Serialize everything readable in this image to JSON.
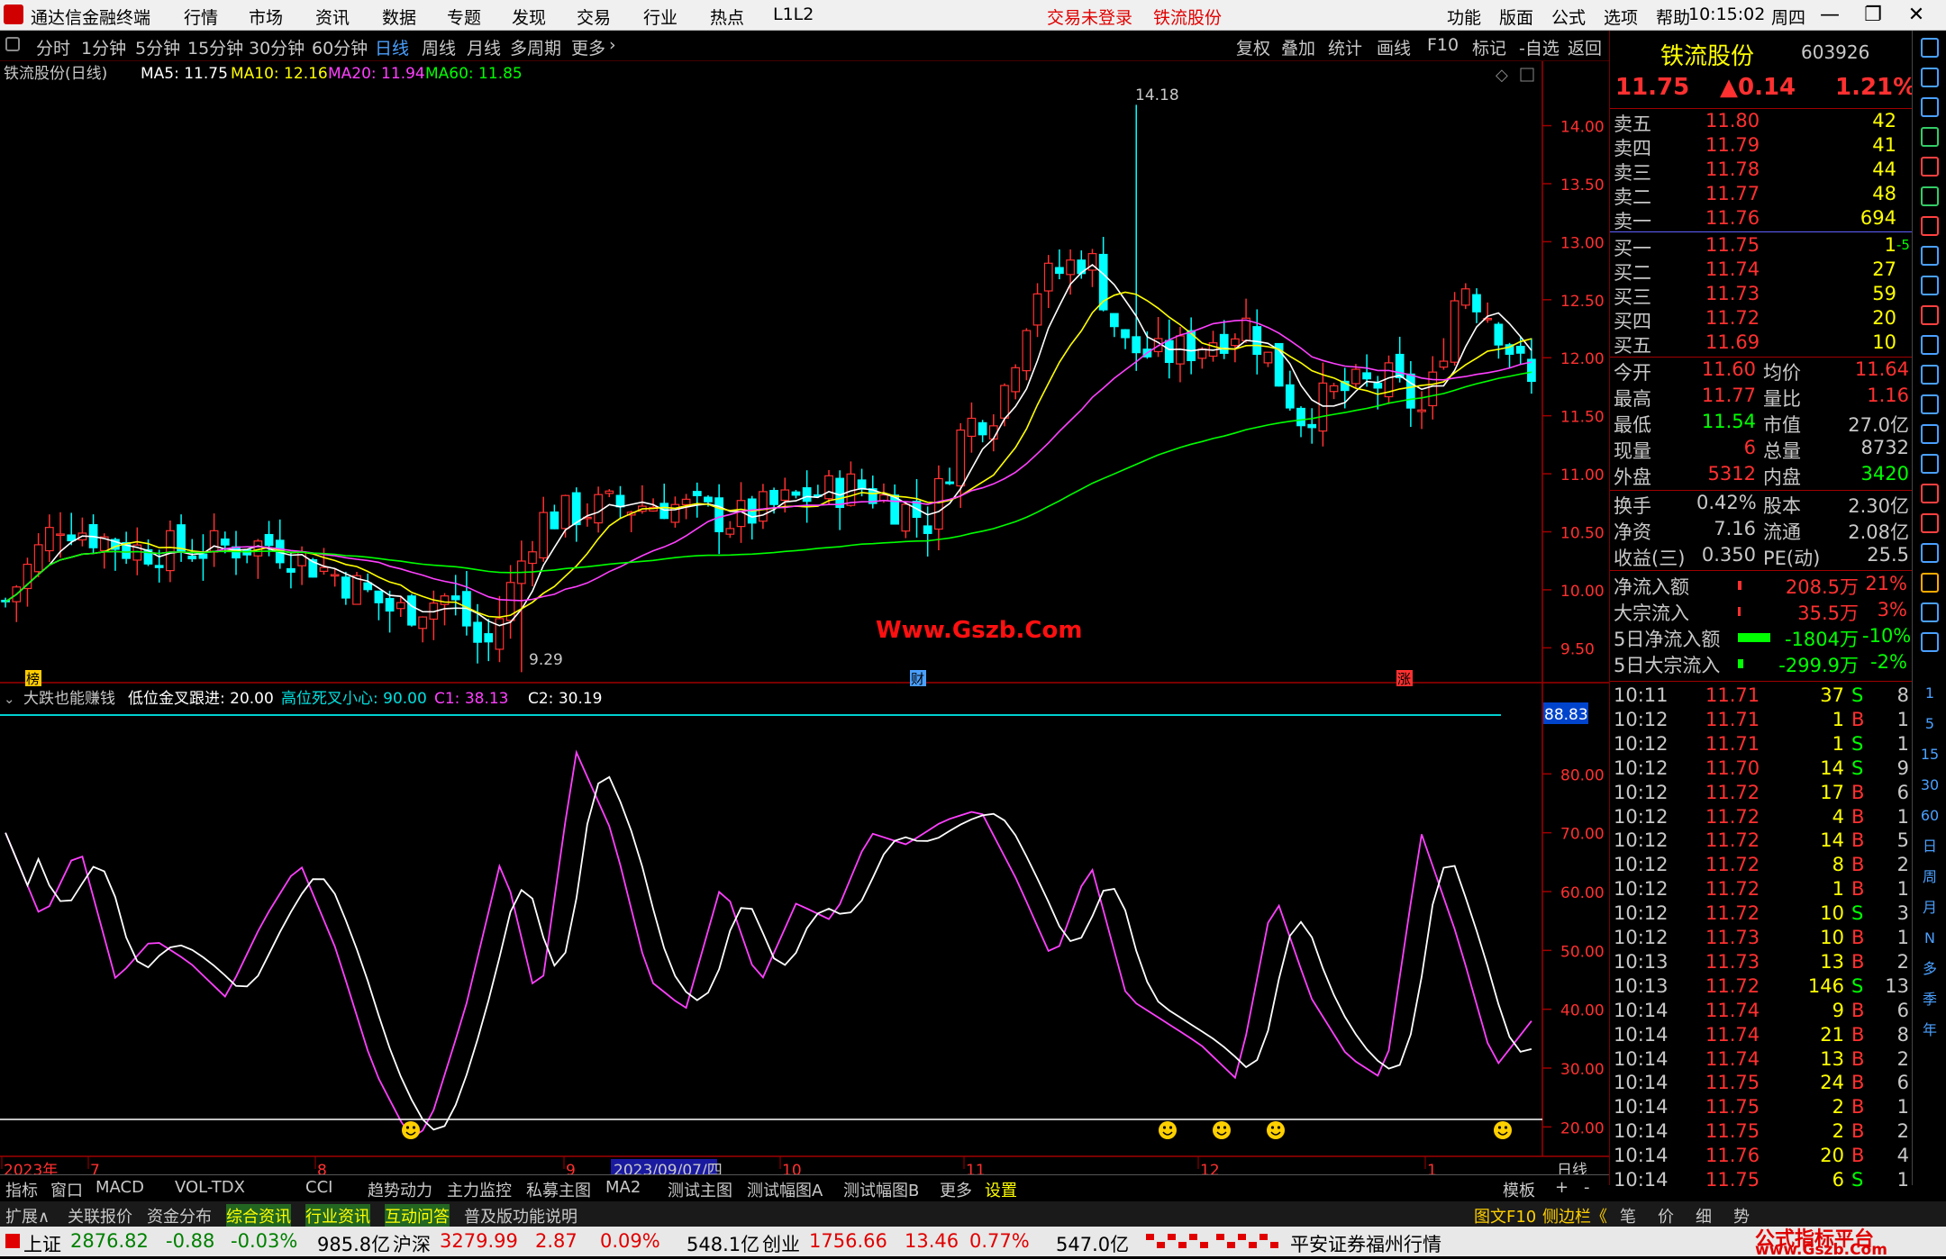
{
  "app": {
    "title": "通达信金融终端",
    "menus": [
      "行情",
      "市场",
      "资讯",
      "数据",
      "专题",
      "发现",
      "交易",
      "行业",
      "热点",
      "L1L2"
    ],
    "status_login": "交易未登录",
    "stock_tag": "铁流股份",
    "right_menus": [
      "功能",
      "版面",
      "公式",
      "选项",
      "帮助"
    ],
    "time": "10:15:02",
    "weekday": "周四"
  },
  "toolbar": {
    "periods": [
      "分时",
      "1分钟",
      "5分钟",
      "15分钟",
      "30分钟",
      "60分钟",
      "日线",
      "周线",
      "月线",
      "多周期",
      "更多"
    ],
    "active": "日线",
    "tools": [
      "复权",
      "叠加",
      "统计",
      "画线",
      "F10",
      "标记",
      "-自选",
      "返回"
    ]
  },
  "main": {
    "title": "铁流股份(日线)",
    "ma": [
      {
        "label": "MA5: 11.75",
        "color": "#ffffff"
      },
      {
        "label": "MA10: 12.16",
        "color": "#ffff00"
      },
      {
        "label": "MA20: 11.94",
        "color": "#ff40ff"
      },
      {
        "label": "MA60: 11.85",
        "color": "#00ff00"
      }
    ],
    "high_label": "14.18",
    "low_label": "9.29",
    "watermark": "Www.Gszb.Com",
    "markers": [
      "榜",
      "财",
      "涨"
    ],
    "yticks": [
      "14.00",
      "13.50",
      "13.00",
      "12.50",
      "12.00",
      "11.50",
      "11.00",
      "10.50",
      "10.00",
      "9.50"
    ]
  },
  "indicator": {
    "name": "大跌也能赚钱",
    "params": [
      {
        "label": "低位金叉跟进: 20.00",
        "color": "#ffffff"
      },
      {
        "label": "高位死叉小心: 90.00",
        "color": "#00e0e0"
      },
      {
        "label": "C1: 38.13",
        "color": "#ff40ff"
      },
      {
        "label": "C2: 30.19",
        "color": "#ffffff"
      }
    ],
    "level_label": "88.83",
    "yticks": [
      "80.00",
      "70.00",
      "60.00",
      "50.00",
      "40.00",
      "30.00",
      "20.00"
    ]
  },
  "xaxis": {
    "labels": [
      "2023年",
      "7",
      "8",
      "9",
      "10",
      "11",
      "12",
      "1"
    ],
    "selected_date": "2023/09/07/四",
    "period_label": "日线"
  },
  "chart_data": {
    "type": "candlestick",
    "symbol": "铁流股份",
    "period": "日线",
    "price_range": [
      9.2,
      14.4
    ],
    "high": 14.18,
    "low": 9.29,
    "ma_last": {
      "MA5": 11.75,
      "MA10": 12.16,
      "MA20": 11.94,
      "MA60": 11.85
    },
    "indicator_range": [
      15,
      90
    ],
    "indicator_last": {
      "C1": 38.13,
      "C2": 30.19
    },
    "lines": {
      "golden_cross": 20.0,
      "death_cross": 90.0
    }
  },
  "quote": {
    "name": "铁流股份",
    "code": "603926",
    "price": "11.75",
    "change": "▲0.14",
    "pct": "1.21%",
    "asks": [
      {
        "label": "卖五",
        "price": "11.80",
        "vol": "42"
      },
      {
        "label": "卖四",
        "price": "11.79",
        "vol": "41"
      },
      {
        "label": "卖三",
        "price": "11.78",
        "vol": "44"
      },
      {
        "label": "卖二",
        "price": "11.77",
        "vol": "48"
      },
      {
        "label": "卖一",
        "price": "11.76",
        "vol": "694"
      }
    ],
    "bids": [
      {
        "label": "买一",
        "price": "11.75",
        "vol": "1",
        "extra": "-5"
      },
      {
        "label": "买二",
        "price": "11.74",
        "vol": "27",
        "extra": ""
      },
      {
        "label": "买三",
        "price": "11.73",
        "vol": "59",
        "extra": ""
      },
      {
        "label": "买四",
        "price": "11.72",
        "vol": "20",
        "extra": ""
      },
      {
        "label": "买五",
        "price": "11.69",
        "vol": "10",
        "extra": ""
      }
    ],
    "stats": [
      {
        "l1": "今开",
        "v1": "11.60",
        "c1": "#ff3030",
        "l2": "均价",
        "v2": "11.64",
        "c2": "#ff3030"
      },
      {
        "l1": "最高",
        "v1": "11.77",
        "c1": "#ff3030",
        "l2": "量比",
        "v2": "1.16",
        "c2": "#ff3030"
      },
      {
        "l1": "最低",
        "v1": "11.54",
        "c1": "#00ff00",
        "l2": "市值",
        "v2": "27.0亿",
        "c2": "#c8c8c8"
      },
      {
        "l1": "现量",
        "v1": "6",
        "c1": "#ff3030",
        "l2": "总量",
        "v2": "8732",
        "c2": "#c8c8c8"
      },
      {
        "l1": "外盘",
        "v1": "5312",
        "c1": "#ff3030",
        "l2": "内盘",
        "v2": "3420",
        "c2": "#00ff00"
      }
    ],
    "stats2": [
      {
        "l1": "换手",
        "v1": "0.42%",
        "l2": "股本",
        "v2": "2.30亿"
      },
      {
        "l1": "净资",
        "v1": "7.16",
        "l2": "流通",
        "v2": "2.08亿"
      },
      {
        "l1": "收益(三)",
        "v1": "0.350",
        "l2": "PE(动)",
        "v2": "25.5"
      }
    ],
    "flows": [
      {
        "label": "净流入额",
        "value": "208.5万",
        "pct": "21%",
        "color": "#ff3030",
        "bar": 0.03
      },
      {
        "label": "大宗流入",
        "value": "35.5万",
        "pct": "3%",
        "color": "#ff3030",
        "bar": 0.015
      },
      {
        "label": "5日净流入额",
        "value": "-1804万",
        "pct": "-10%",
        "color": "#00ff00",
        "bar": 0.3
      },
      {
        "label": "5日大宗流入",
        "value": "-299.9万",
        "pct": "-2%",
        "color": "#00ff00",
        "bar": 0.05
      }
    ],
    "ticks": [
      [
        "10:11",
        "11.71",
        "37",
        "S",
        "8"
      ],
      [
        "10:12",
        "11.71",
        "1",
        "B",
        "1"
      ],
      [
        "10:12",
        "11.71",
        "1",
        "S",
        "1"
      ],
      [
        "10:12",
        "11.70",
        "14",
        "S",
        "9"
      ],
      [
        "10:12",
        "11.72",
        "17",
        "B",
        "6"
      ],
      [
        "10:12",
        "11.72",
        "4",
        "B",
        "1"
      ],
      [
        "10:12",
        "11.72",
        "14",
        "B",
        "5"
      ],
      [
        "10:12",
        "11.72",
        "8",
        "B",
        "2"
      ],
      [
        "10:12",
        "11.72",
        "1",
        "B",
        "1"
      ],
      [
        "10:12",
        "11.72",
        "10",
        "S",
        "3"
      ],
      [
        "10:12",
        "11.73",
        "10",
        "B",
        "1"
      ],
      [
        "10:13",
        "11.73",
        "13",
        "B",
        "2"
      ],
      [
        "10:13",
        "11.72",
        "146",
        "S",
        "13"
      ],
      [
        "10:14",
        "11.74",
        "9",
        "B",
        "6"
      ],
      [
        "10:14",
        "11.74",
        "21",
        "B",
        "8"
      ],
      [
        "10:14",
        "11.74",
        "13",
        "B",
        "2"
      ],
      [
        "10:14",
        "11.75",
        "24",
        "B",
        "6"
      ],
      [
        "10:14",
        "11.75",
        "2",
        "B",
        "1"
      ],
      [
        "10:14",
        "11.75",
        "2",
        "B",
        "2"
      ],
      [
        "10:14",
        "11.76",
        "20",
        "B",
        "4"
      ],
      [
        "10:14",
        "11.75",
        "6",
        "S",
        "1"
      ]
    ]
  },
  "sidebar": [
    "1",
    "5",
    "15",
    "30",
    "60",
    "日",
    "周",
    "月",
    "N",
    "多",
    "季",
    "年"
  ],
  "tabs1": [
    "指标",
    "窗口",
    "MACD",
    "VOL-TDX",
    "CCI",
    "趋势动力",
    "主力监控",
    "私募主图",
    "MA2",
    "测试主图",
    "测试幅图A",
    "测试幅图B",
    "更多",
    "设置",
    "模板",
    "+",
    "-"
  ],
  "tabs2": [
    "扩展∧",
    "关联报价",
    "资金分布",
    "综合资讯",
    "行业资讯",
    "互动问答",
    "普及版功能说明",
    "图文F10",
    "侧边栏《",
    "笔",
    "价",
    "细",
    "势"
  ],
  "status": {
    "indices": [
      {
        "name": "上证",
        "value": "2876.82",
        "chg": "-0.88",
        "pct": "-0.03%",
        "amt": "985.8亿",
        "color": "#008000"
      },
      {
        "name": "沪深",
        "value": "3279.99",
        "chg": "2.87",
        "pct": "0.09%",
        "amt": "548.1亿",
        "color": "#e00000"
      },
      {
        "name": "创业",
        "value": "1756.66",
        "chg": "13.46",
        "pct": "0.77%",
        "amt": "547.0亿",
        "color": "#e00000"
      }
    ],
    "broker": "平安证券福州行情",
    "brand1": "公式指标平台",
    "brand2": "www.Gszb.Com"
  }
}
